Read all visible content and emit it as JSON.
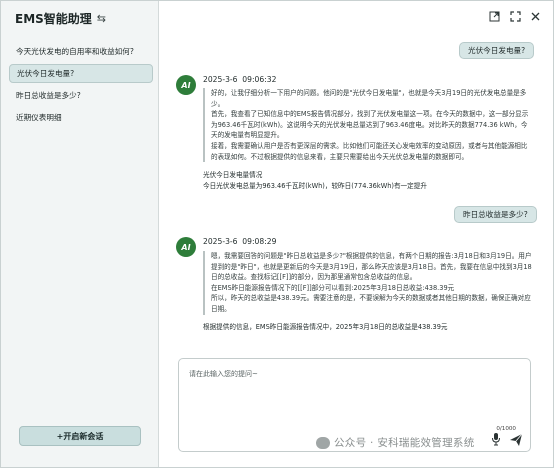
{
  "app": {
    "title": "EMS智能助理",
    "toggle_icon": "⇆"
  },
  "window": {
    "expand_icon": "expand-icon",
    "fullscreen_icon": "fullscreen-icon",
    "close_icon": "close-icon"
  },
  "sidebar": {
    "items": [
      {
        "label": "今天光伏发电的自用率和收益如何?",
        "active": false
      },
      {
        "label": "光伏今日发电量?",
        "active": true
      },
      {
        "label": "昨日总收益是多少?",
        "active": false
      },
      {
        "label": "近期仪表明细",
        "active": false
      }
    ],
    "new_chat_label": "+开启新会话"
  },
  "chat": {
    "messages": [
      {
        "role": "user",
        "text": "光伏今日发电量?"
      },
      {
        "role": "assistant",
        "avatar": "AI",
        "timestamp": "2025-3-6  09:06:32",
        "think": [
          "好的，让我仔细分析一下用户的问题。他问的是\"光伏今日发电量\"，也就是今天3月19日的光伏发电总量是多少。",
          "首先，我查看了已知信息中的EMS报告情况部分，找到了光伏发电量这一项。在今天的数据中，这一部分显示为963.46千瓦时(kWh)。这说明今天的光伏发电总量达到了963.46度电。对比昨天的数据774.36 kWh，今天的发电量有明显提升。",
          "接着，我需要确认用户是否有更深层的需求。比如他们可能还关心发电效率的变动原因，或者与其他能源相比的表现如何。不过根据提供的信息来看，主要只需要给出今天光伏总发电量的数据即可。"
        ],
        "answer": [
          "光伏今日发电量情况",
          "今日光伏发电总量为963.46千瓦时(kWh)，较昨日(774.36kWh)有一定提升"
        ]
      },
      {
        "role": "user",
        "text": "昨日总收益是多少?"
      },
      {
        "role": "assistant",
        "avatar": "AI",
        "timestamp": "2025-3-6  09:08:29",
        "think": [
          "嗯，我需要回答的问题是\"昨日总收益是多少?\"根据提供的信息，有两个日期的报告:3月18日和3月19日。用户提到的是\"昨日\"，也就是更新后的今天是3月19日，那么昨天应该是3月18日。首先，我要在信息中找到3月18日的总收益。查找标记[[F]]的部分，因为那里通常包含总收益的信息。",
          "在EMS昨日能源报告情况下的[[F]]部分可以看到:2025年3月18日总收益:438.39元",
          "所以，昨天的总收益是438.39元。需要注意的是，不要误解为今天的数据或者其他日期的数据，确保正确对应日期。"
        ],
        "answer": [
          "根据提供的信息，EMS昨日能源报告情况中，2025年3月18日的总收益是438.39元"
        ]
      }
    ]
  },
  "input": {
    "placeholder": "请在此输入您的提问~",
    "char_count": "0/1000",
    "mic_icon": "mic-icon",
    "send_icon": "send-icon"
  },
  "watermark": {
    "text": "公众号 · 安科瑞能效管理系统"
  },
  "colors": {
    "accent": "#d7e6e6",
    "avatar": "#2e7d3a",
    "new_chat_bg": "#c9dede"
  }
}
